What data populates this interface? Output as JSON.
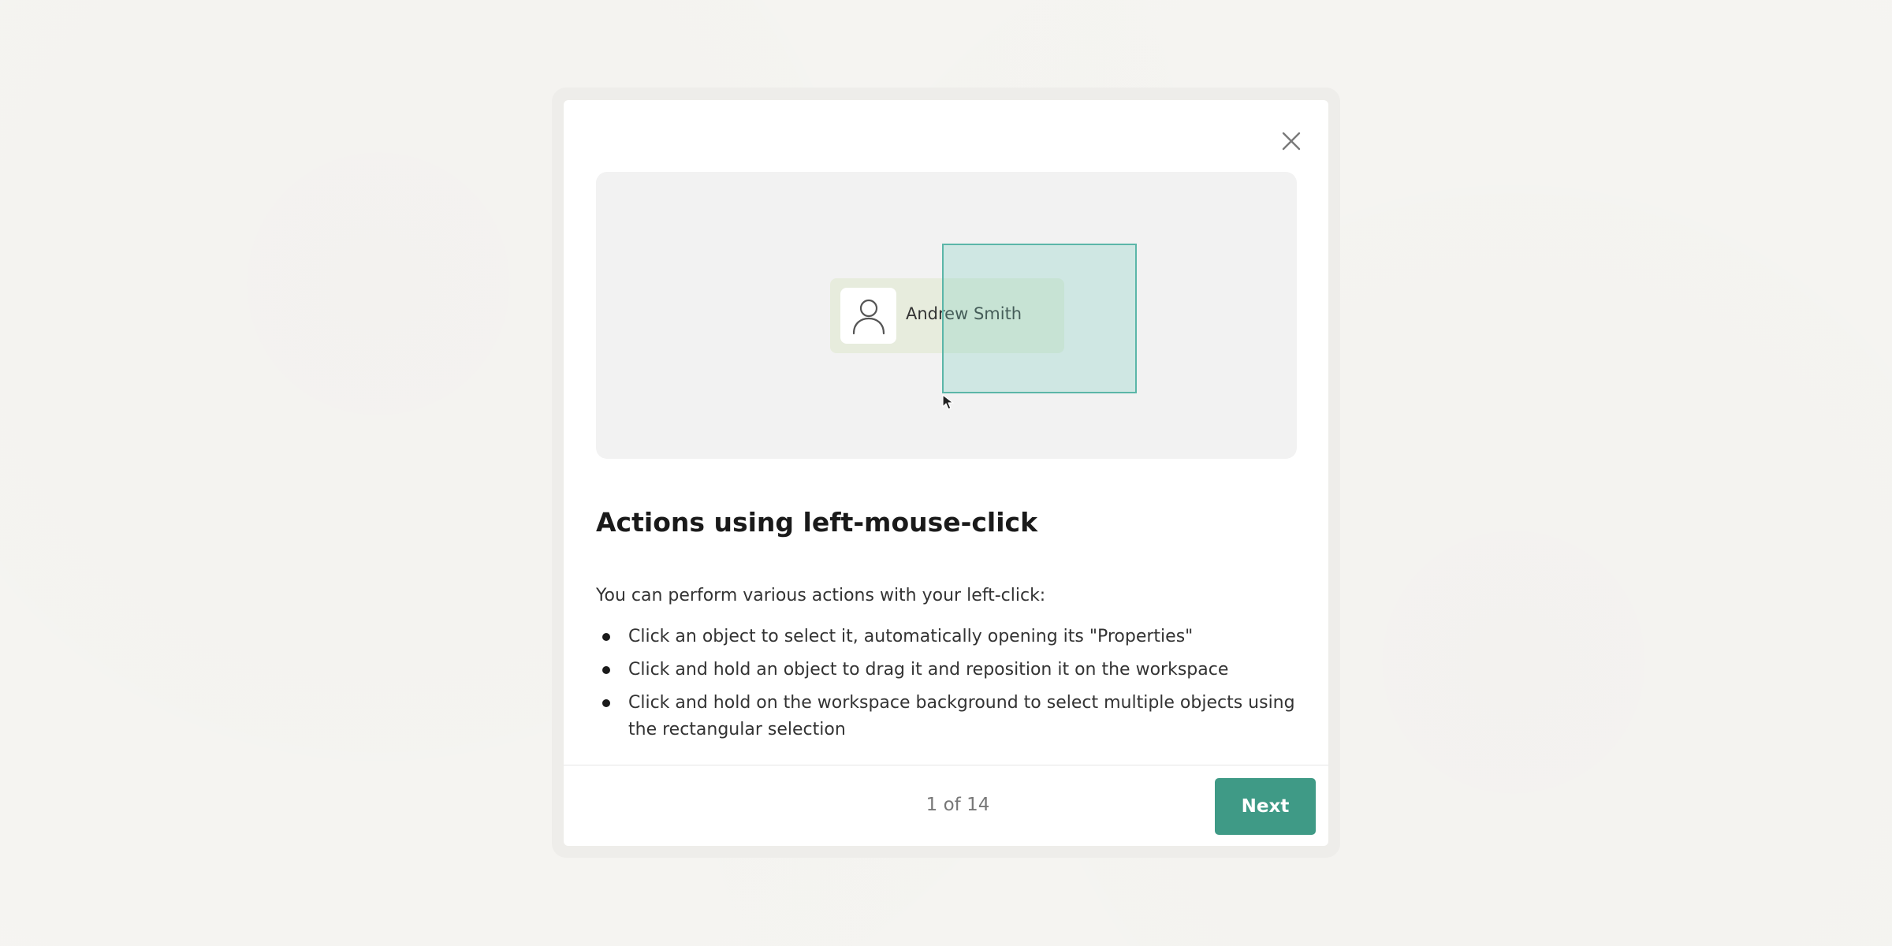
{
  "dialog": {
    "close_icon": "close-icon",
    "illustration": {
      "person_name": "Andrew Smith",
      "avatar_icon": "user-icon",
      "cursor_icon": "mouse-pointer-icon",
      "selection_color": "#5bb6a8"
    },
    "title": "Actions using left-mouse-click",
    "intro": "You can perform various actions with your left-click:",
    "bullets": [
      "Click an object to select it, automatically opening its \"Properties\"",
      "Click and hold an object to drag it and reposition it on the workspace",
      "Click and hold on the workspace background to select multiple objects using the rectangular selection"
    ],
    "pager": "1 of 14",
    "next_label": "Next",
    "accent_color": "#3f9a86"
  }
}
